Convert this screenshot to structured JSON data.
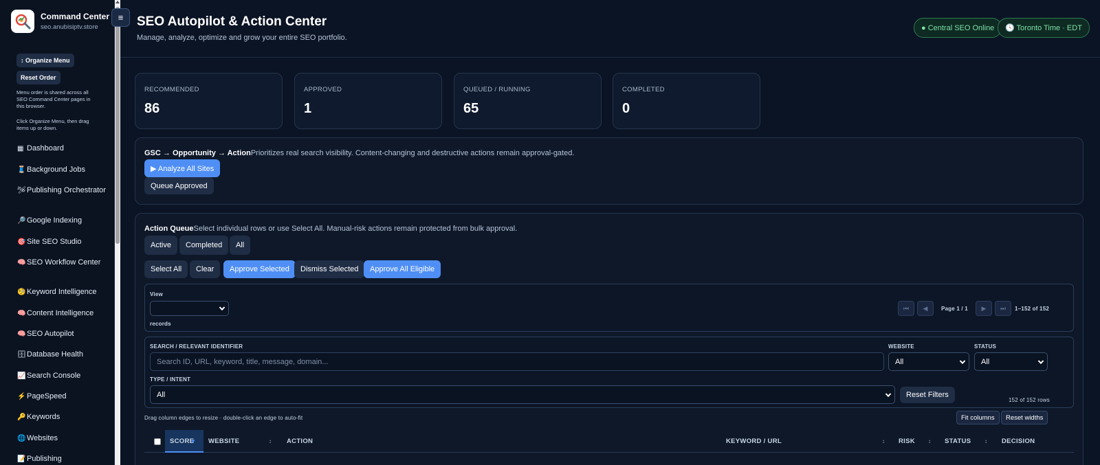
{
  "app": {
    "title": "Command Center",
    "domain": "seo.anubisiptv.store",
    "menu_toggle_icon": "≡"
  },
  "sidebar": {
    "organize_label": "↕ Organize Menu",
    "reset_label": "Reset Order",
    "note1": "Menu order is shared across all SEO Command Center pages in this browser.",
    "note2": "Click Organize Menu, then drag items up or down.",
    "items": [
      {
        "icon": "▦",
        "label": "Dashboard"
      },
      {
        "icon": "🧵",
        "label": "Background Jobs"
      },
      {
        "icon": "🛩",
        "label": "Publishing Orchestrator"
      },
      {
        "icon": "🔎",
        "label": "Google Indexing"
      },
      {
        "icon": "🎯",
        "label": "Site SEO Studio"
      },
      {
        "icon": "🧠",
        "label": "SEO Workflow Center"
      },
      {
        "icon": "🧐",
        "label": "Keyword Intelligence"
      },
      {
        "icon": "🧠",
        "label": "Content Intelligence"
      },
      {
        "icon": "🧠",
        "label": "SEO Autopilot"
      },
      {
        "icon": "🗄",
        "label": "Database Health"
      },
      {
        "icon": "📈",
        "label": "Search Console"
      },
      {
        "icon": "⚡",
        "label": "PageSpeed"
      },
      {
        "icon": "🔑",
        "label": "Keywords"
      },
      {
        "icon": "🌐",
        "label": "Websites"
      },
      {
        "icon": "📝",
        "label": "Publishing"
      }
    ]
  },
  "header": {
    "title": "SEO Autopilot & Action Center",
    "subtitle": "Manage, analyze, optimize and grow your entire SEO portfolio.",
    "status_pill": "● Central SEO Online",
    "time_pill": "🕓 Toronto Time · EDT"
  },
  "stats": [
    {
      "label": "RECOMMENDED",
      "value": "86"
    },
    {
      "label": "APPROVED",
      "value": "1"
    },
    {
      "label": "QUEUED / RUNNING",
      "value": "65"
    },
    {
      "label": "COMPLETED",
      "value": "0"
    }
  ],
  "gsc": {
    "title": "GSC → Opportunity → Action",
    "desc": "Prioritizes real search visibility. Content-changing and destructive actions remain approval-gated.",
    "analyze_label": "▶ Analyze All Sites",
    "queue_label": "Queue Approved"
  },
  "queue": {
    "title": "Action Queue",
    "desc": "Select individual rows or use Select All. Manual-risk actions remain protected from bulk approval.",
    "tabs": [
      "Active",
      "Completed",
      "All"
    ],
    "actions": {
      "select_all": "Select All",
      "clear": "Clear",
      "approve_selected": "Approve Selected",
      "dismiss_selected": "Dismiss Selected",
      "approve_all": "Approve All Eligible"
    },
    "view": {
      "label": "View",
      "value": "",
      "records": "records",
      "page_label": "Page 1 / 1",
      "range": "1–152 of 152",
      "first_icon": "⏮",
      "prev_icon": "◀",
      "next_icon": "▶",
      "last_icon": "⏭"
    },
    "filters": {
      "search_label": "SEARCH / RELEVANT IDENTIFIER",
      "search_placeholder": "Search ID, URL, keyword, title, message, domain...",
      "website_label": "WEBSITE",
      "website_value": "All",
      "status_label": "STATUS",
      "status_value": "All",
      "type_label": "TYPE / INTENT",
      "type_value": "All",
      "reset_label": "Reset Filters",
      "row_count": "152 of 152 rows"
    },
    "table": {
      "hint": "Drag column edges to resize · double-click an edge to auto-fit",
      "fit_label": "Fit columns",
      "reset_widths_label": "Reset widths",
      "sort_icon": "↕",
      "active_sort_icon": "▼",
      "columns": {
        "score": "SCORE",
        "website": "WEBSITE",
        "action": "ACTION",
        "keyword": "KEYWORD / URL",
        "risk": "RISK",
        "status": "STATUS",
        "decision": "DECISION"
      }
    }
  }
}
